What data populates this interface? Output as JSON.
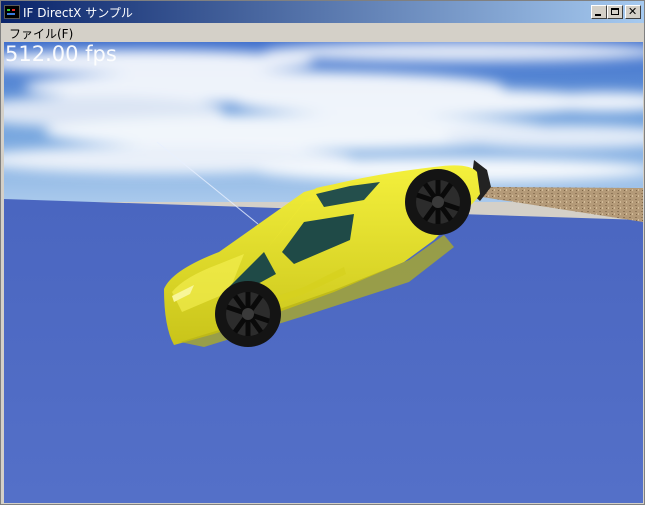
{
  "window": {
    "title": "IF DirectX サンプル",
    "icon": "directx-app-icon",
    "minimize_icon": "minimize-icon",
    "maximize_icon": "maximize-icon",
    "close_icon": "close-icon"
  },
  "menu": {
    "items": [
      {
        "label": "ファイル(F)"
      }
    ]
  },
  "viewport": {
    "fps_text": "512.00 fps"
  },
  "colors": {
    "title_start": "#0a246a",
    "title_end": "#a6caf0",
    "ground": "#4e6bc3",
    "car_body": "#e2de28",
    "window_glass": "#1f4a47",
    "terrain": "#b49a78"
  }
}
